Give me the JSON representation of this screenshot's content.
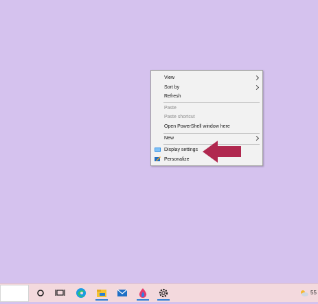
{
  "context_menu": {
    "items": [
      {
        "label": "View",
        "has_submenu": true,
        "enabled": true
      },
      {
        "label": "Sort by",
        "has_submenu": true,
        "enabled": true
      },
      {
        "label": "Refresh",
        "has_submenu": false,
        "enabled": true
      },
      {
        "label": "Paste",
        "has_submenu": false,
        "enabled": false
      },
      {
        "label": "Paste shortcut",
        "has_submenu": false,
        "enabled": false
      },
      {
        "label": "Open PowerShell window here",
        "has_submenu": false,
        "enabled": true
      },
      {
        "label": "New",
        "has_submenu": true,
        "enabled": true
      },
      {
        "label": "Display settings",
        "icon": "display-icon",
        "enabled": true
      },
      {
        "label": "Personalize",
        "icon": "personalize-icon",
        "enabled": true
      }
    ]
  },
  "annotation": {
    "color": "#b0284f",
    "points_to": "Display settings"
  },
  "taskbar": {
    "icons": [
      "search-box",
      "cortana-icon",
      "task-view-icon",
      "edge-icon",
      "file-explorer-icon",
      "mail-icon",
      "paint-icon",
      "settings-icon"
    ],
    "temperature": "55",
    "weather_icon": "partly-cloudy-icon"
  },
  "colors": {
    "desktop": "#d5c2ee",
    "taskbar": "#f3d9dd",
    "accent": "#2b7fd6"
  }
}
